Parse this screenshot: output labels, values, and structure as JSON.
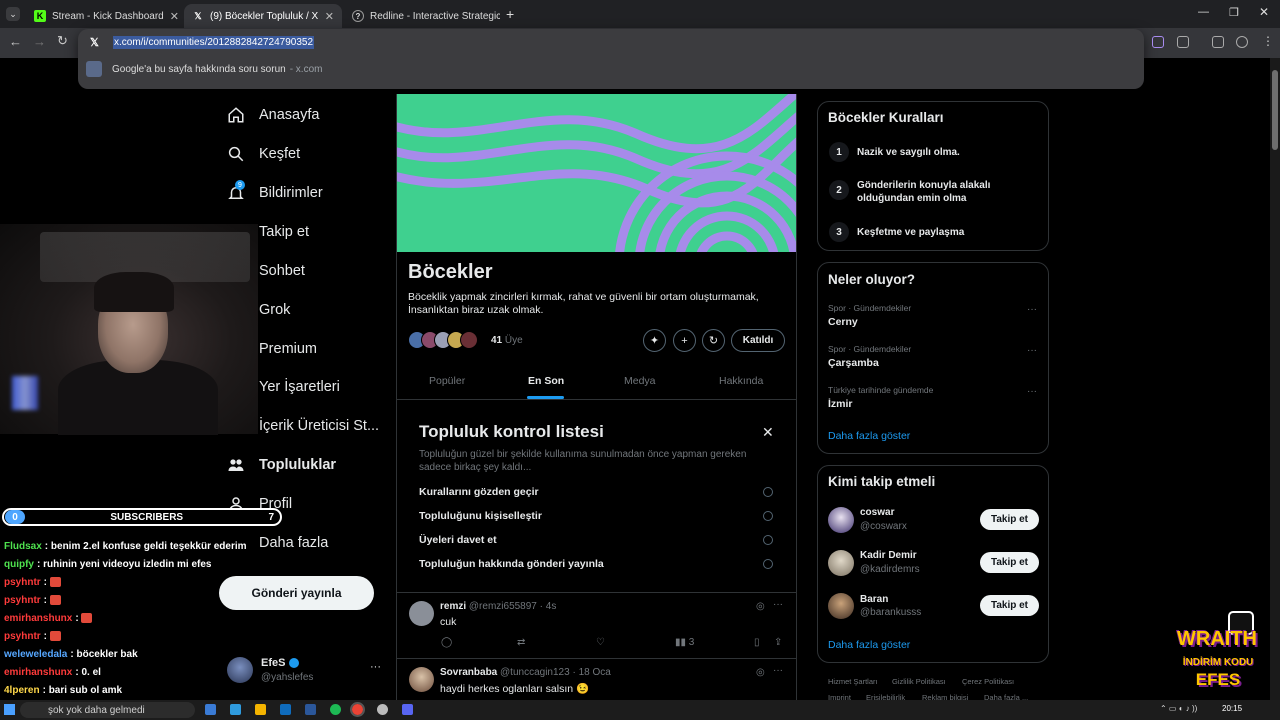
{
  "browser": {
    "tabs": [
      {
        "title": "Stream - Kick Dashboard",
        "icon": "kick-icon"
      },
      {
        "title": "(9) Böcekler Topluluk / X",
        "icon": "x-icon",
        "active": true
      },
      {
        "title": "Redline - Interactive Strategic N",
        "icon": "redline-icon"
      }
    ],
    "new_tab": "+",
    "url": "x.com/i/communities/2012882842724790352",
    "suggestion": "Google'a bu sayfa hakkında soru sorun",
    "suggestion_source": "- x.com"
  },
  "sidebar": {
    "items": [
      {
        "label": "Anasayfa",
        "icon": "home-icon"
      },
      {
        "label": "Keşfet",
        "icon": "search-icon"
      },
      {
        "label": "Bildirimler",
        "icon": "bell-icon",
        "badge": "9"
      },
      {
        "label": "Takip et",
        "icon": "follow-icon"
      },
      {
        "label": "Sohbet",
        "icon": "chat-icon"
      },
      {
        "label": "Grok",
        "icon": "grok-icon"
      },
      {
        "label": "Premium",
        "icon": "x-logo-icon"
      },
      {
        "label": "Yer İşaretleri",
        "icon": "bookmark-icon"
      },
      {
        "label": "İçerik Üreticisi St...",
        "icon": "creator-icon"
      },
      {
        "label": "Topluluklar",
        "icon": "communities-icon",
        "active": true
      },
      {
        "label": "Profil",
        "icon": "person-icon"
      },
      {
        "label": "Daha fazla",
        "icon": "more-icon"
      }
    ],
    "post_button": "Gönderi yayınla",
    "account": {
      "name": "EfeS",
      "handle": "@yahslefes",
      "more": "···"
    }
  },
  "stream_overlay": {
    "subscribers": {
      "left": "0",
      "label": "SUBSCRIBERS",
      "right": "7"
    },
    "chat": [
      {
        "user": "Fludsax",
        "color": "#4fe34f",
        "text": "benim 2.el konfuse geldi teşekkür ederim"
      },
      {
        "user": "quipfy",
        "color": "#4fe34f",
        "text": "ruhinin yeni videoyu izledin mi efes"
      },
      {
        "user": "psyhntr",
        "color": "#ff3b3b",
        "text": "",
        "emote": true
      },
      {
        "user": "psyhntr",
        "color": "#ff3b3b",
        "text": "",
        "emote": true
      },
      {
        "user": "emirhanshunx",
        "color": "#ff3b3b",
        "text": "",
        "emote": true
      },
      {
        "user": "psyhntr",
        "color": "#ff3b3b",
        "text": "",
        "emote": true
      },
      {
        "user": "weleweledala",
        "color": "#56a7ff",
        "text": "böcekler bak"
      },
      {
        "user": "emirhanshunx",
        "color": "#ff3b3b",
        "text": "0. el"
      },
      {
        "user": "4lperen",
        "color": "#ffd84a",
        "text": "bari sub ol amk"
      }
    ],
    "promo": {
      "line1": "WRAITH",
      "line2": "İNDİRİM KODU",
      "line3": "EFES"
    }
  },
  "community": {
    "name": "Böcekler",
    "description": "Böceklik yapmak zincirleri kırmak, rahat ve güvenli bir ortam oluşturmamak, İnsanlıktan biraz uzak olmak.",
    "members_count": "41",
    "members_label": "Üye",
    "join_button": "Katıldı",
    "tabs": [
      "Popüler",
      "En Son",
      "Medya",
      "Hakkında"
    ],
    "active_tab": "En Son"
  },
  "checklist": {
    "title": "Topluluk kontrol listesi",
    "close": "✕",
    "description": "Topluluğun güzel bir şekilde kullanıma sunulmadan önce yapman gereken sadece birkaç şey kaldı...",
    "items": [
      "Kurallarını gözden geçir",
      "Topluluğunu kişiselleştir",
      "Üyeleri davet et",
      "Topluluğun hakkında gönderi yayınla"
    ]
  },
  "posts": [
    {
      "name": "remzi",
      "handle": "@remzi655897",
      "time": "· 4s",
      "text": "cuk",
      "views": "3"
    },
    {
      "name": "Sovranbaba",
      "handle": "@tunccagin123",
      "time": "· 18 Oca",
      "text": "haydi herkes oglanları salsın 😉"
    }
  ],
  "rules": {
    "title": "Böcekler Kuralları",
    "items": [
      {
        "num": "1",
        "text": "Nazik ve saygılı olma."
      },
      {
        "num": "2",
        "text": "Gönderilerin konuyla alakalı olduğundan emin olma"
      },
      {
        "num": "3",
        "text": "Keşfetme ve paylaşma"
      }
    ]
  },
  "trends": {
    "title": "Neler oluyor?",
    "items": [
      {
        "category": "Spor · Gündemdekiler",
        "name": "Cerny"
      },
      {
        "category": "Spor · Gündemdekiler",
        "name": "Çarşamba"
      },
      {
        "category": "Türkiye tarihinde gündemde",
        "name": "İzmir"
      }
    ],
    "more": "Daha fazla göster"
  },
  "who_to_follow": {
    "title": "Kimi takip etmeli",
    "items": [
      {
        "name": "coswar",
        "handle": "@coswarx",
        "button": "Takip et"
      },
      {
        "name": "Kadir Demir",
        "handle": "@kadirdemrs",
        "button": "Takip et"
      },
      {
        "name": "Baran",
        "handle": "@barankusss",
        "button": "Takip et"
      }
    ],
    "more": "Daha fazla göster"
  },
  "footer": [
    "Hizmet Şartları",
    "Gizlilik Politikası",
    "Çerez Politikası",
    "Imprint",
    "Erişilebilirlik",
    "Reklam bilgisi",
    "Daha fazla ..."
  ],
  "taskbar": {
    "search": "şok yok daha gelmedi",
    "time": "20:15"
  }
}
